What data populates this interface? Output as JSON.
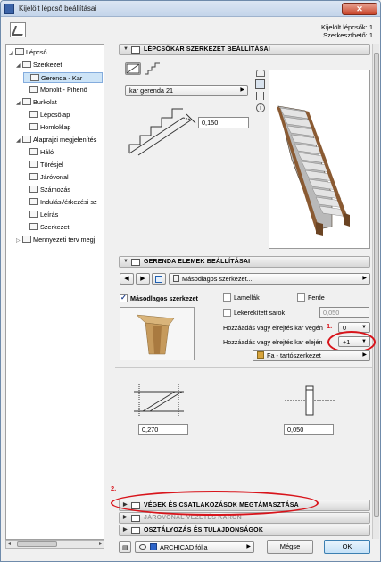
{
  "window": {
    "title": "Kijelölt lépcső beállításai",
    "close_glyph": "✕"
  },
  "selection": {
    "selected_label": "Kijelölt lépcsők: 1",
    "editable_label": "Szerkeszthető: 1"
  },
  "tree": {
    "items": [
      {
        "label": "Lépcső",
        "toggle": "◢"
      },
      {
        "label": "Szerkezet",
        "toggle": "◢"
      },
      {
        "label": "Gerenda - Kar",
        "toggle": ""
      },
      {
        "label": "Monolit - Pihenő",
        "toggle": ""
      },
      {
        "label": "Burkolat",
        "toggle": "◢"
      },
      {
        "label": "Lépcsőlap",
        "toggle": ""
      },
      {
        "label": "Homloklap",
        "toggle": ""
      },
      {
        "label": "Alaprajzi megjelenítés",
        "toggle": "◢"
      },
      {
        "label": "Háló",
        "toggle": ""
      },
      {
        "label": "Törésjel",
        "toggle": ""
      },
      {
        "label": "Járóvonal",
        "toggle": ""
      },
      {
        "label": "Számozás",
        "toggle": ""
      },
      {
        "label": "Indulási/érkezési sz",
        "toggle": ""
      },
      {
        "label": "Leírás",
        "toggle": ""
      },
      {
        "label": "Szerkezet",
        "toggle": ""
      },
      {
        "label": "Mennyezeti terv megj",
        "toggle": "▷"
      }
    ],
    "scroll_left": "◂",
    "scroll_right": "▸"
  },
  "stringer_section": {
    "title": "LÉPCSŐKAR SZERKEZET BEÁLLÍTÁSAI",
    "arrow": "▼",
    "type_dropdown": "kar gerenda 21",
    "thickness_value": "0,150"
  },
  "beam_section": {
    "title": "GERENDA ELEMEK BEÁLLÍTÁSAI",
    "arrow": "▼",
    "prev_glyph": "◀",
    "next_glyph": "▶",
    "element_dropdown": "Másodlagos szerkezet...",
    "secondary_checkbox_label": "Másodlagos szerkezet",
    "lamellas_label": "Lamellák",
    "slanted_label": "Ferde",
    "rounded_corner_label": "Lekerekített sarok",
    "rounded_value": "0,050",
    "add_end_label": "Hozzáadás vagy elrejtés kar végén",
    "add_end_value": "0",
    "add_start_label": "Hozzáadás vagy elrejtés kar elején",
    "add_start_value": "+1",
    "material_label": "Fa - tartószerkezet",
    "dim_left_value": "0,270",
    "dim_right_value": "0,050"
  },
  "collapsed_sections": [
    {
      "arrow": "▶",
      "label": "VÉGEK ÉS CSATLAKOZÁSOK MEGTÁMASZTÁSA"
    },
    {
      "arrow": "▶",
      "label": "JÁRÓVONAL VEZETÉS KARON"
    },
    {
      "arrow": "▶",
      "label": "OSZTÁLYOZÁS ÉS TULAJDONSÁGOK"
    }
  ],
  "annotations": {
    "marker_1": "1.",
    "marker_2": "2."
  },
  "footer": {
    "layer_label": "ARCHICAD fólia",
    "cancel_label": "Mégse",
    "ok_label": "OK"
  },
  "colors": {
    "annotation": "#d8141b",
    "selection": "#cde4f7"
  }
}
